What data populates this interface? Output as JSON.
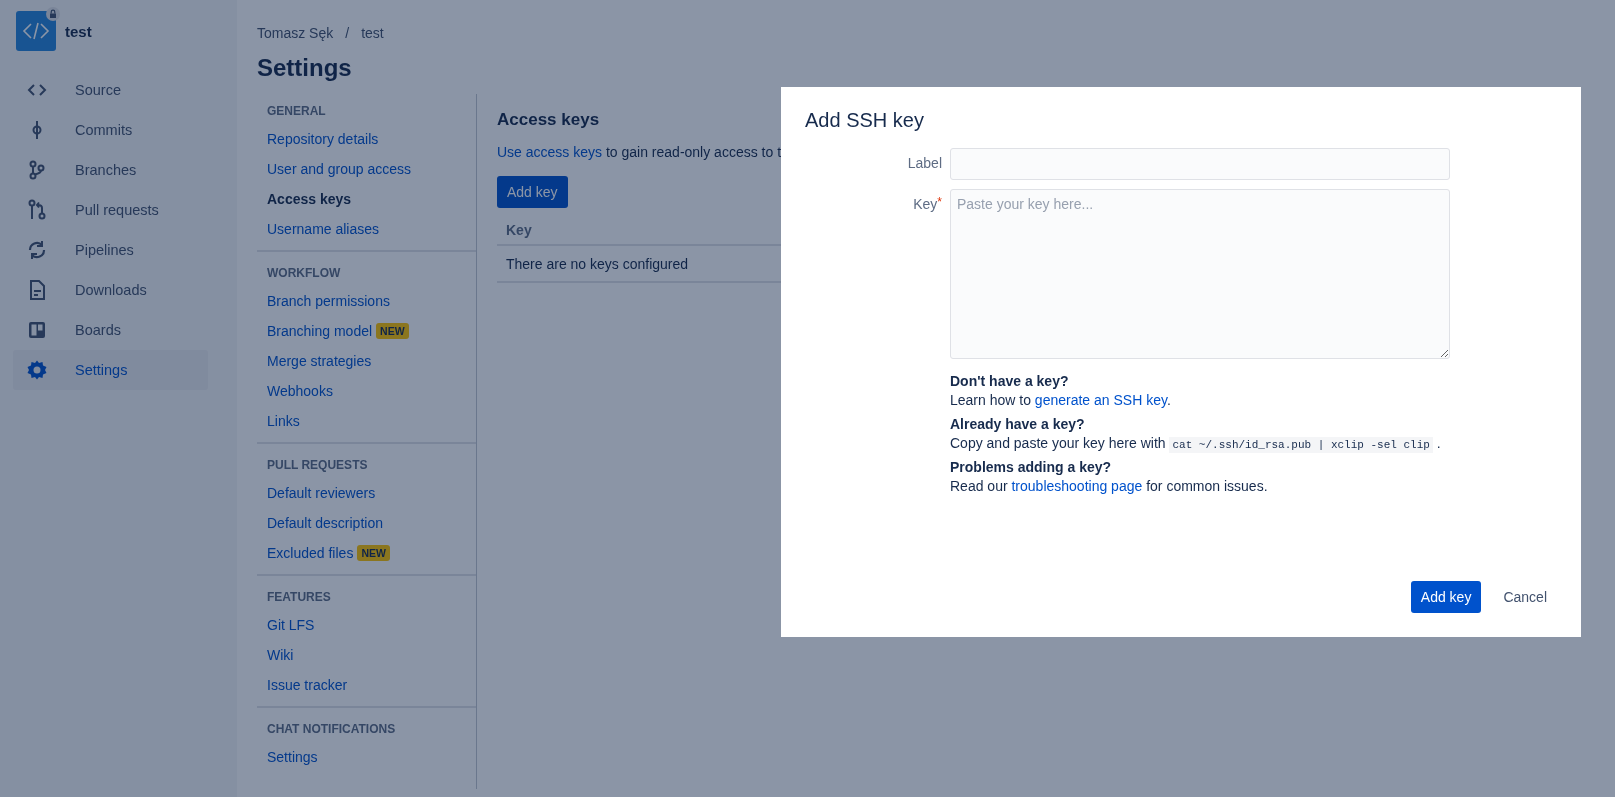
{
  "repository": {
    "name": "test"
  },
  "sidebar": {
    "items": [
      {
        "label": "Source",
        "selected": false
      },
      {
        "label": "Commits",
        "selected": false
      },
      {
        "label": "Branches",
        "selected": false
      },
      {
        "label": "Pull requests",
        "selected": false
      },
      {
        "label": "Pipelines",
        "selected": false
      },
      {
        "label": "Downloads",
        "selected": false
      },
      {
        "label": "Boards",
        "selected": false
      },
      {
        "label": "Settings",
        "selected": true
      }
    ]
  },
  "breadcrumb": {
    "owner": "Tomasz Sęk",
    "separator": "/",
    "repo": "test"
  },
  "page_title": "Settings",
  "settings_nav": {
    "sections": [
      {
        "heading": "GENERAL",
        "items": [
          {
            "label": "Repository details",
            "selected": false
          },
          {
            "label": "User and group access",
            "selected": false
          },
          {
            "label": "Access keys",
            "selected": true
          },
          {
            "label": "Username aliases",
            "selected": false
          }
        ]
      },
      {
        "heading": "WORKFLOW",
        "items": [
          {
            "label": "Branch permissions",
            "selected": false
          },
          {
            "label": "Branching model",
            "selected": false,
            "badge": "NEW"
          },
          {
            "label": "Merge strategies",
            "selected": false
          },
          {
            "label": "Webhooks",
            "selected": false
          },
          {
            "label": "Links",
            "selected": false
          }
        ]
      },
      {
        "heading": "PULL REQUESTS",
        "items": [
          {
            "label": "Default reviewers",
            "selected": false
          },
          {
            "label": "Default description",
            "selected": false
          },
          {
            "label": "Excluded files",
            "selected": false,
            "badge": "NEW"
          }
        ]
      },
      {
        "heading": "FEATURES",
        "items": [
          {
            "label": "Git LFS",
            "selected": false
          },
          {
            "label": "Wiki",
            "selected": false
          },
          {
            "label": "Issue tracker",
            "selected": false
          }
        ]
      },
      {
        "heading": "CHAT NOTIFICATIONS",
        "items": [
          {
            "label": "Settings",
            "selected": false
          }
        ]
      }
    ]
  },
  "content": {
    "title": "Access keys",
    "description": [
      {
        "kind": "link",
        "text": "Use access keys"
      },
      {
        "kind": "text",
        "text": " to gain read-only access to t"
      }
    ],
    "add_button": "Add key",
    "table": {
      "columns": [
        "Key"
      ],
      "empty_message": "There are no keys configured"
    }
  },
  "dialog": {
    "title": "Add SSH key",
    "fields": [
      {
        "kind": "input",
        "label": "Label"
      },
      {
        "kind": "textarea",
        "label": "Key",
        "required_mark": "*",
        "placeholder": "Paste your key here..."
      }
    ],
    "help": [
      {
        "heading": "Don't have a key?",
        "text": [
          {
            "kind": "text",
            "text": "Learn how to "
          },
          {
            "kind": "link",
            "text": "generate an SSH key"
          },
          {
            "kind": "text",
            "text": "."
          }
        ]
      },
      {
        "heading": "Already have a key?",
        "text": [
          {
            "kind": "text",
            "text": "Copy and paste your key here with "
          },
          {
            "kind": "code",
            "text": "cat ~/.ssh/id_rsa.pub | xclip -sel clip"
          },
          {
            "kind": "text",
            "text": " ."
          }
        ]
      },
      {
        "heading": "Problems adding a key?",
        "text": [
          {
            "kind": "text",
            "text": "Read our "
          },
          {
            "kind": "link",
            "text": "troubleshooting page"
          },
          {
            "kind": "text",
            "text": " for common issues."
          }
        ]
      }
    ],
    "buttons": [
      {
        "kind": "primary",
        "label": "Add key"
      },
      {
        "kind": "subtle",
        "label": "Cancel"
      }
    ]
  }
}
